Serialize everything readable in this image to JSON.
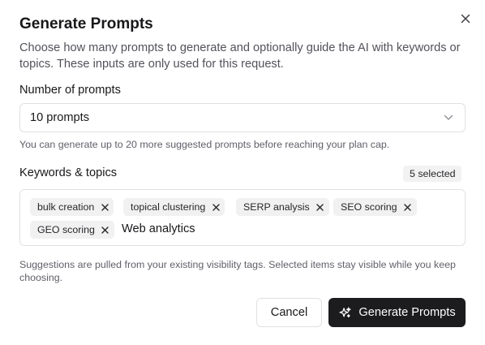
{
  "dialog": {
    "title": "Generate Prompts",
    "description": "Choose how many prompts to generate and optionally guide the AI with keywords or topics. These inputs are only used for this request.",
    "close_icon": "close-icon"
  },
  "count_field": {
    "label": "Number of prompts",
    "selected_value": "10 prompts",
    "hint": "You can generate up to 20 more suggested prompts before reaching your plan cap."
  },
  "keywords": {
    "label": "Keywords & topics",
    "selected_badge": "5 selected",
    "tags": [
      "bulk creation",
      "topical clustering",
      "SERP analysis",
      "SEO scoring",
      "GEO scoring"
    ],
    "input_value": "Web analytics",
    "footnote": "Suggestions are pulled from your existing visibility tags. Selected items stay visible while you keep choosing."
  },
  "actions": {
    "cancel_label": "Cancel",
    "generate_label": "Generate Prompts",
    "generate_icon": "sparkles-icon"
  },
  "colors": {
    "primary_button": "#1c1c1f",
    "chip_bg": "#f1f1f2",
    "border": "#e1e1e4",
    "muted_text": "#60606a"
  }
}
